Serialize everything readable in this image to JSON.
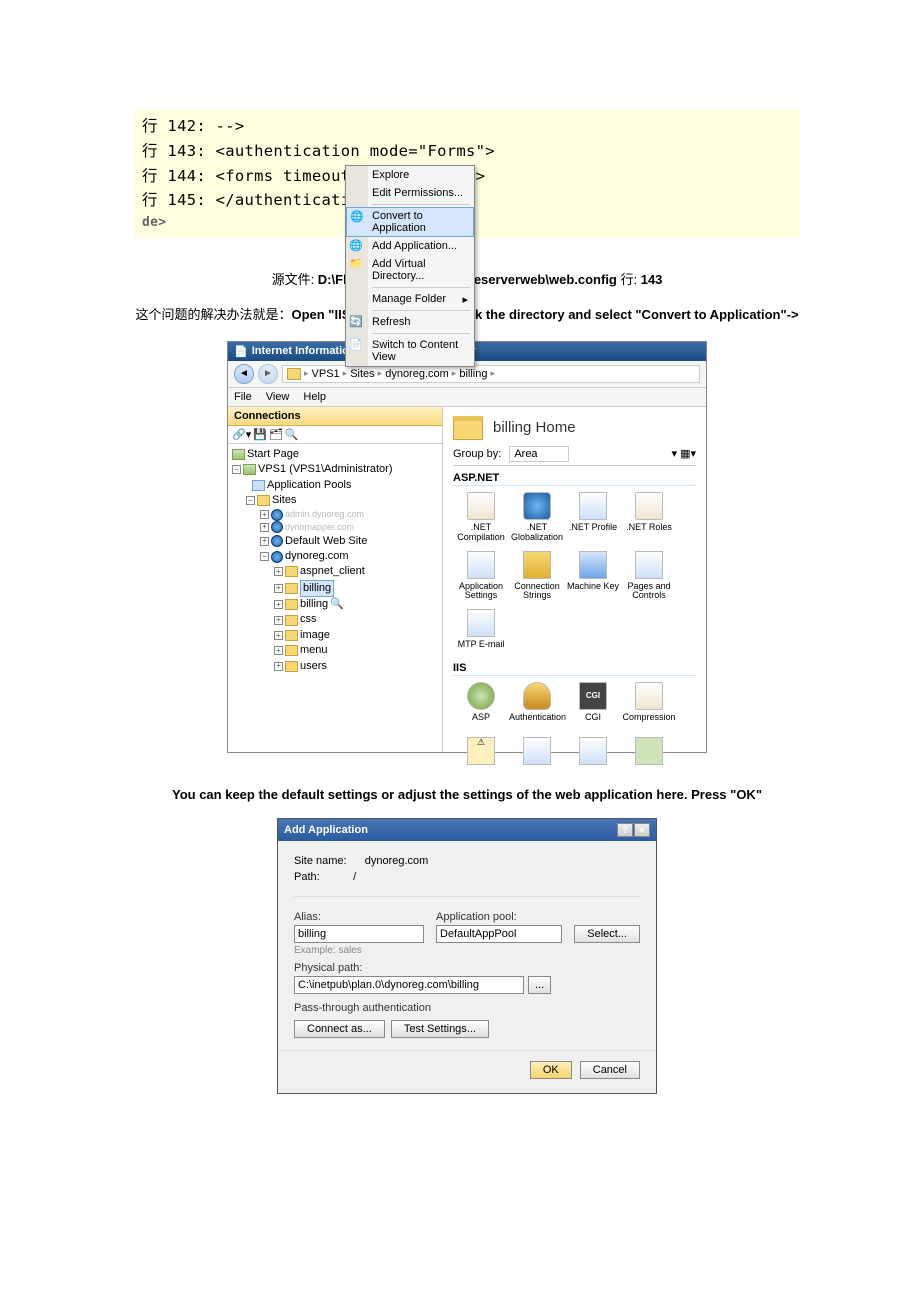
{
  "code": {
    "l1": "行 142:        -->",
    "l2": "行 143:  <authentication mode=\"Forms\">",
    "l3": "行 144:   <forms timeout=\"30\"></forms>",
    "l4": "行 145:  </authentication>",
    "de": "de>"
  },
  "captions": {
    "src_prefix": "源文件: ",
    "src_path": "D:\\Flex\\GuangJie\\guangjieserverweb\\web.config",
    "src_line_label": "  行: ",
    "src_line": "143",
    "sol_prefix": "这个问题的解决办法就是：",
    "sol_bold": "Open \"IIS Manager\", right click the directory and select \"Convert to Application\"->",
    "mid": "You can keep the default settings or adjust the settings of the web application here. Press \"OK\""
  },
  "iis": {
    "title": "Internet Information Services (IIS) Manager",
    "crumbs": [
      "VPS1",
      "Sites",
      "dynoreg.com",
      "billing"
    ],
    "menubar": [
      "File",
      "View",
      "Help"
    ],
    "connections_hdr": "Connections",
    "tree": {
      "start": "Start Page",
      "server": "VPS1 (VPS1\\Administrator)",
      "apppools": "Application Pools",
      "sites": "Sites",
      "defweb": "Default Web Site",
      "dyno": "dynoreg.com",
      "aspnet": "aspnet_client",
      "billing": "billing",
      "billing2": "billing",
      "css": "css",
      "images": "image",
      "menu": "menu",
      "users": "users"
    },
    "ctx": {
      "explore": "Explore",
      "editperm": "Edit Permissions...",
      "convert": "Convert to Application",
      "addapp": "Add Application...",
      "addvdir": "Add Virtual Directory...",
      "manage": "Manage Folder",
      "refresh": "Refresh",
      "switch": "Switch to Content View"
    },
    "right": {
      "title": "billing  Home",
      "groupby_lbl": "Group by:",
      "groupby_val": "Area",
      "cat_aspnet": "ASP.NET",
      "cat_iis": "IIS",
      "icons_aspnet": [
        ".NET Compilation",
        ".NET Globalization",
        ".NET Profile",
        ".NET Roles",
        "Application Settings",
        "Connection Strings",
        "Machine Key",
        "Pages and Controls",
        "MTP E-mail"
      ],
      "icons_iis": [
        "ASP",
        "Authentication",
        "CGI",
        "Compression"
      ]
    }
  },
  "dlg": {
    "title": "Add Application",
    "siteName_lbl": "Site name:",
    "siteName_val": "dynoreg.com",
    "path_lbl": "Path:",
    "path_val": "/",
    "alias_lbl": "Alias:",
    "alias_val": "billing",
    "alias_hint": "Example: sales",
    "apppool_lbl": "Application pool:",
    "apppool_val": "DefaultAppPool",
    "select_btn": "Select...",
    "phys_lbl": "Physical path:",
    "phys_val": "C:\\inetpub\\plan.0\\dynoreg.com\\billing",
    "browse": "...",
    "passthru": "Pass-through authentication",
    "connectas": "Connect as...",
    "testset": "Test Settings...",
    "ok": "OK",
    "cancel": "Cancel",
    "help": "?",
    "close": "×"
  }
}
